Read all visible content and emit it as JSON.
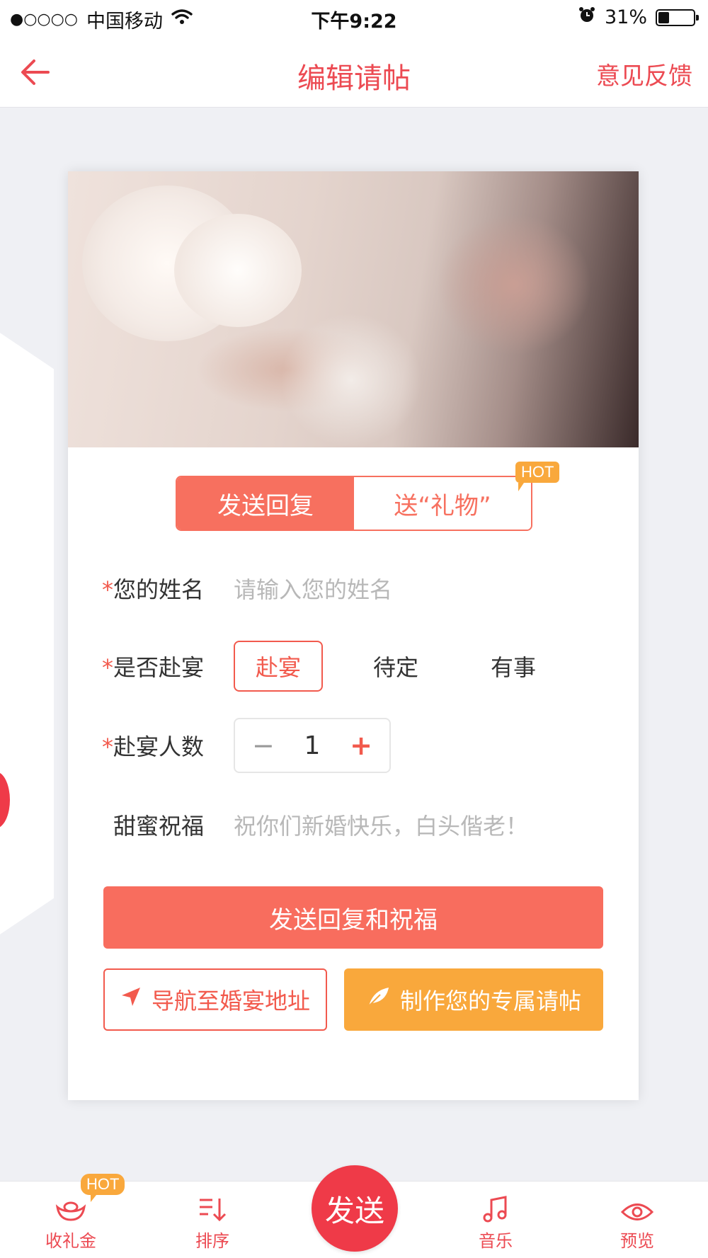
{
  "status_bar": {
    "signal": "●○○○○",
    "carrier": "中国移动",
    "time": "下午9:22",
    "battery_text": "31%",
    "battery_level": 0.31
  },
  "nav": {
    "title": "编辑请帖",
    "feedback": "意见反馈"
  },
  "card": {
    "tabs": [
      {
        "label": "发送回复",
        "active": true
      },
      {
        "label": "送“礼物”",
        "active": false
      }
    ],
    "hot_badge": "HOT",
    "form": {
      "name_label": "您的姓名",
      "name_placeholder": "请输入您的姓名",
      "attend_label": "是否赴宴",
      "attend_options": [
        "赴宴",
        "待定",
        "有事"
      ],
      "attend_selected": "赴宴",
      "count_label": "赴宴人数",
      "count_minus": "−",
      "count_value": "1",
      "count_plus": "+",
      "wish_label": "甜蜜祝福",
      "wish_placeholder": "祝你们新婚快乐，白头偕老！",
      "required_mark": "*"
    },
    "primary_button": "发送回复和祝福",
    "navigate_button": "导航至婚宴地址",
    "make_button": "制作您的专属请帖"
  },
  "bottom_bar": {
    "items": [
      {
        "label": "收礼金",
        "icon": "ingot-icon"
      },
      {
        "label": "排序",
        "icon": "sort-icon"
      },
      {
        "label": "音乐",
        "icon": "music-icon"
      },
      {
        "label": "预览",
        "icon": "eye-icon"
      }
    ],
    "send": "发送",
    "hot_badge": "HOT"
  },
  "colors": {
    "brand_red": "#ec4a52",
    "coral": "#f86d5e",
    "orange": "#f9a83c"
  }
}
